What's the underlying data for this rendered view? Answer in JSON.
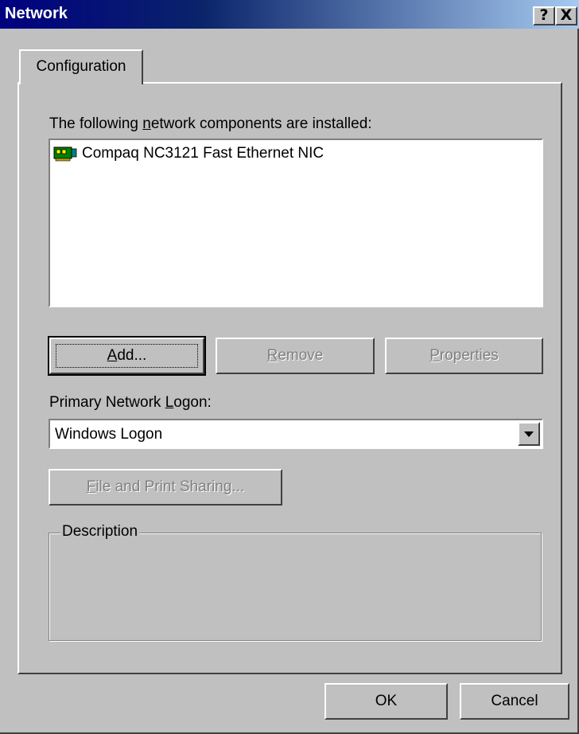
{
  "window": {
    "title": "Network",
    "help_button": "?",
    "close_button": "X"
  },
  "tab": {
    "label": "Configuration"
  },
  "components": {
    "label_prefix": "The following ",
    "label_access_key": "n",
    "label_suffix": "etwork components are installed:",
    "items": [
      {
        "label": "Compaq NC3121 Fast Ethernet NIC",
        "icon": "network-adapter-icon"
      }
    ]
  },
  "buttons": {
    "add_access_key": "A",
    "add_rest": "dd...",
    "remove_prefix": "",
    "remove_access_key": "R",
    "remove_rest": "emove",
    "properties_access_key": "P",
    "properties_rest": "roperties"
  },
  "primary_logon": {
    "label_prefix": "Primary Network ",
    "label_access_key": "L",
    "label_suffix": "ogon:",
    "selected": "Windows Logon"
  },
  "file_sharing": {
    "access_key": "F",
    "rest": "ile and Print Sharing..."
  },
  "description": {
    "legend": "Description",
    "text": ""
  },
  "footer": {
    "ok_label": "OK",
    "cancel_label": "Cancel"
  }
}
